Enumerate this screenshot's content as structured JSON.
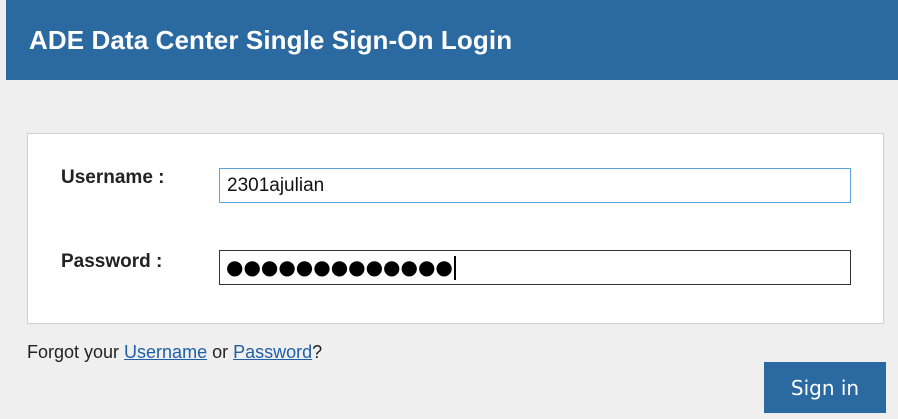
{
  "header": {
    "title": "ADE Data Center Single Sign-On Login"
  },
  "form": {
    "username_label": "Username :",
    "username_value": "2301ajulian",
    "password_label": "Password :",
    "password_mask": "●●●●●●●●●●●●●"
  },
  "forgot": {
    "prefix": "Forgot your ",
    "username_link": "Username",
    "middle": " or ",
    "password_link": "Password",
    "suffix": "?"
  },
  "actions": {
    "signin_label": "Sign in"
  },
  "colors": {
    "brand": "#2b69a1",
    "link": "#1f5fa5",
    "focus_border": "#5aa6dc",
    "background": "#efefef"
  }
}
